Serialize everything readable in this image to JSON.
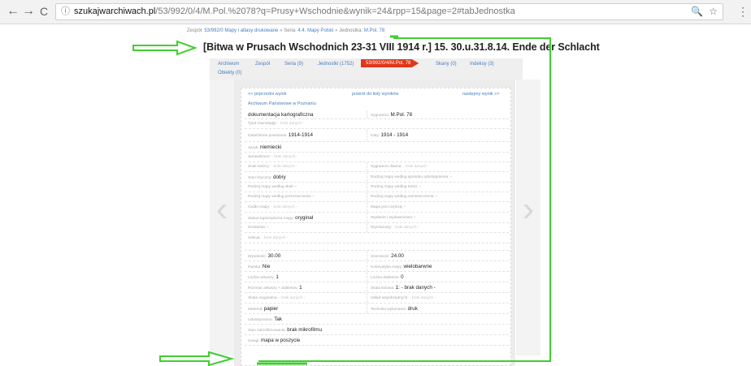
{
  "browser": {
    "back": "←",
    "forward": "→",
    "reload": "C",
    "info_icon": "ⓘ",
    "url_host": "szukajwarchiwach.pl",
    "url_path": "/53/992/0/4/M.Pol.%2078?q=Prusy+Wschodnie&wynik=24&rpp=15&page=2#tabJednostka",
    "zoom_icon": "🔍",
    "star_icon": "☆",
    "menu_icon": "⋮"
  },
  "breadcrumb": {
    "prefix": "Zespół: ",
    "zespol": "53/992/0 Mapy i atlasy drukowane",
    "sep1": " » Seria: ",
    "seria": "4.4. Mapy Polski",
    "sep2": " » Jednostka: ",
    "jednostka": "M.Pol. 78"
  },
  "title": "[Bitwa w Prusach Wschodnich 23-31 VIII 1914 r.] 15. 30.u.31.8.14. Ende der Schlacht",
  "tabs": [
    {
      "label": "Archiwum"
    },
    {
      "label": "Zespół"
    },
    {
      "label": "Seria (9)"
    },
    {
      "label": "Jednostki (1752)"
    },
    {
      "label": "53/992/0/4/M.Pol. 78"
    },
    {
      "label": "Skany (0)"
    },
    {
      "label": "Indeksy (3)"
    },
    {
      "label": "Obiekty (0)"
    }
  ],
  "record": {
    "prev": "<< poprzedni wynik",
    "back": "powrót do listy wyników",
    "next": "następny wynik >>",
    "archive": "Archiwum Państwowe w Poznaniu",
    "rows": [
      {
        "l_label": "",
        "l_val": "dokumentacja kartograficzna",
        "r_label": "Sygnatura: ",
        "r_val": "M.Pol. 78"
      },
      {
        "l_label": "Tytuł równoległy: ",
        "l_val": "- brak danych -",
        "l_nodata": true,
        "r_label": "",
        "r_val": ""
      },
      {
        "l_label": "Data/Okres powstania: ",
        "l_val": "1914-1914",
        "r_label": "Daty: ",
        "r_val": "1914 - 1914"
      },
      {
        "l_label": "Język: ",
        "l_val": "niemiecki",
        "r_label": "",
        "r_val": ""
      },
      {
        "l_label": "Sprawdzono: ",
        "l_val": "- brak danych -",
        "l_nodata": true,
        "r_label": "",
        "r_val": ""
      },
      {
        "l_label": "Znak twórcy: ",
        "l_val": "- brak danych -",
        "l_nodata": true,
        "r_label": "Sygnatura dawna: ",
        "r_val": "- brak danych -",
        "r_nodata": true
      },
      {
        "l_label": "Stan fizyczny: ",
        "l_val": "dobry",
        "r_label": "Rodzaj mapy według sposobu udostępnienia: ",
        "r_val": "•",
        "r_nodata": true
      },
      {
        "l_label": "Rodzaj mapy według skali: ",
        "l_val": "•",
        "l_nodata": true,
        "r_label": "Rodzaj mapy według treści: ",
        "r_val": "•",
        "r_nodata": true
      },
      {
        "l_label": "Rodzaj mapy według przeznaczenia: ",
        "l_val": "•",
        "l_nodata": true,
        "r_label": "Rodzaj mapy według zamieszczenia: ",
        "r_val": "•",
        "r_nodata": true
      },
      {
        "l_label": "Godło mapy: ",
        "l_val": "- brak danych -",
        "l_nodata": true,
        "r_label": "Mapa jest częścią: ",
        "r_val": "•",
        "r_nodata": true
      },
      {
        "l_label": "Status egzemplarza mapy: ",
        "l_val": "oryginał",
        "r_label": "Wydanie / wydawnictwo: ",
        "r_val": "•",
        "r_nodata": true
      },
      {
        "l_label": "Drukarnia: ",
        "l_val": "•",
        "l_nodata": true,
        "r_label": "Wymiarowy: ",
        "r_val": "- brak danych -",
        "r_nodata": true
      },
      {
        "l_label": "Sekcja: ",
        "l_val": "- brak danych -",
        "l_nodata": true,
        "r_label": "",
        "r_val": ""
      },
      {
        "l_label": "",
        "l_val": "",
        "r_label": "",
        "r_val": ""
      },
      {
        "l_label": "Wysokość: ",
        "l_val": "30.00",
        "r_label": "Szerokość: ",
        "r_val": "24.00"
      },
      {
        "l_label": "Ramka: ",
        "l_val": "Nie",
        "r_label": "Kolorystyka mapy: ",
        "r_val": "wielobarwne"
      },
      {
        "l_label": "Liczba arkuszy: ",
        "l_val": "1",
        "r_label": "Liczba dubletów: ",
        "r_val": "0"
      },
      {
        "l_label": "Rozmiar arkuszy + dubletów: ",
        "l_val": "1",
        "r_label": "Skala liniowa: ",
        "r_val": "1: - brak danych -",
        "r_nodata_partial": true
      },
      {
        "l_label": "Skala oryginalna: ",
        "l_val": "- brak danych -",
        "l_nodata": true,
        "r_label": "Układ współrzędnych: ",
        "r_val": "- brak danych -",
        "r_nodata": true
      },
      {
        "l_label": "Materiał: ",
        "l_val": "papier",
        "r_label": "Technika wykonania: ",
        "r_val": "druk"
      },
      {
        "l_label": "Udostępniona: ",
        "l_val": "Tak",
        "r_label": "",
        "r_val": ""
      },
      {
        "l_label": "Stan mikrofilmowania: ",
        "l_val": "brak mikrofilmu",
        "r_label": "",
        "r_val": ""
      },
      {
        "l_label": "Uwagi: ",
        "l_val": "mapa w poszycie",
        "r_label": "",
        "r_val": ""
      }
    ]
  },
  "annotations": {
    "color": "#3fcf2f"
  }
}
